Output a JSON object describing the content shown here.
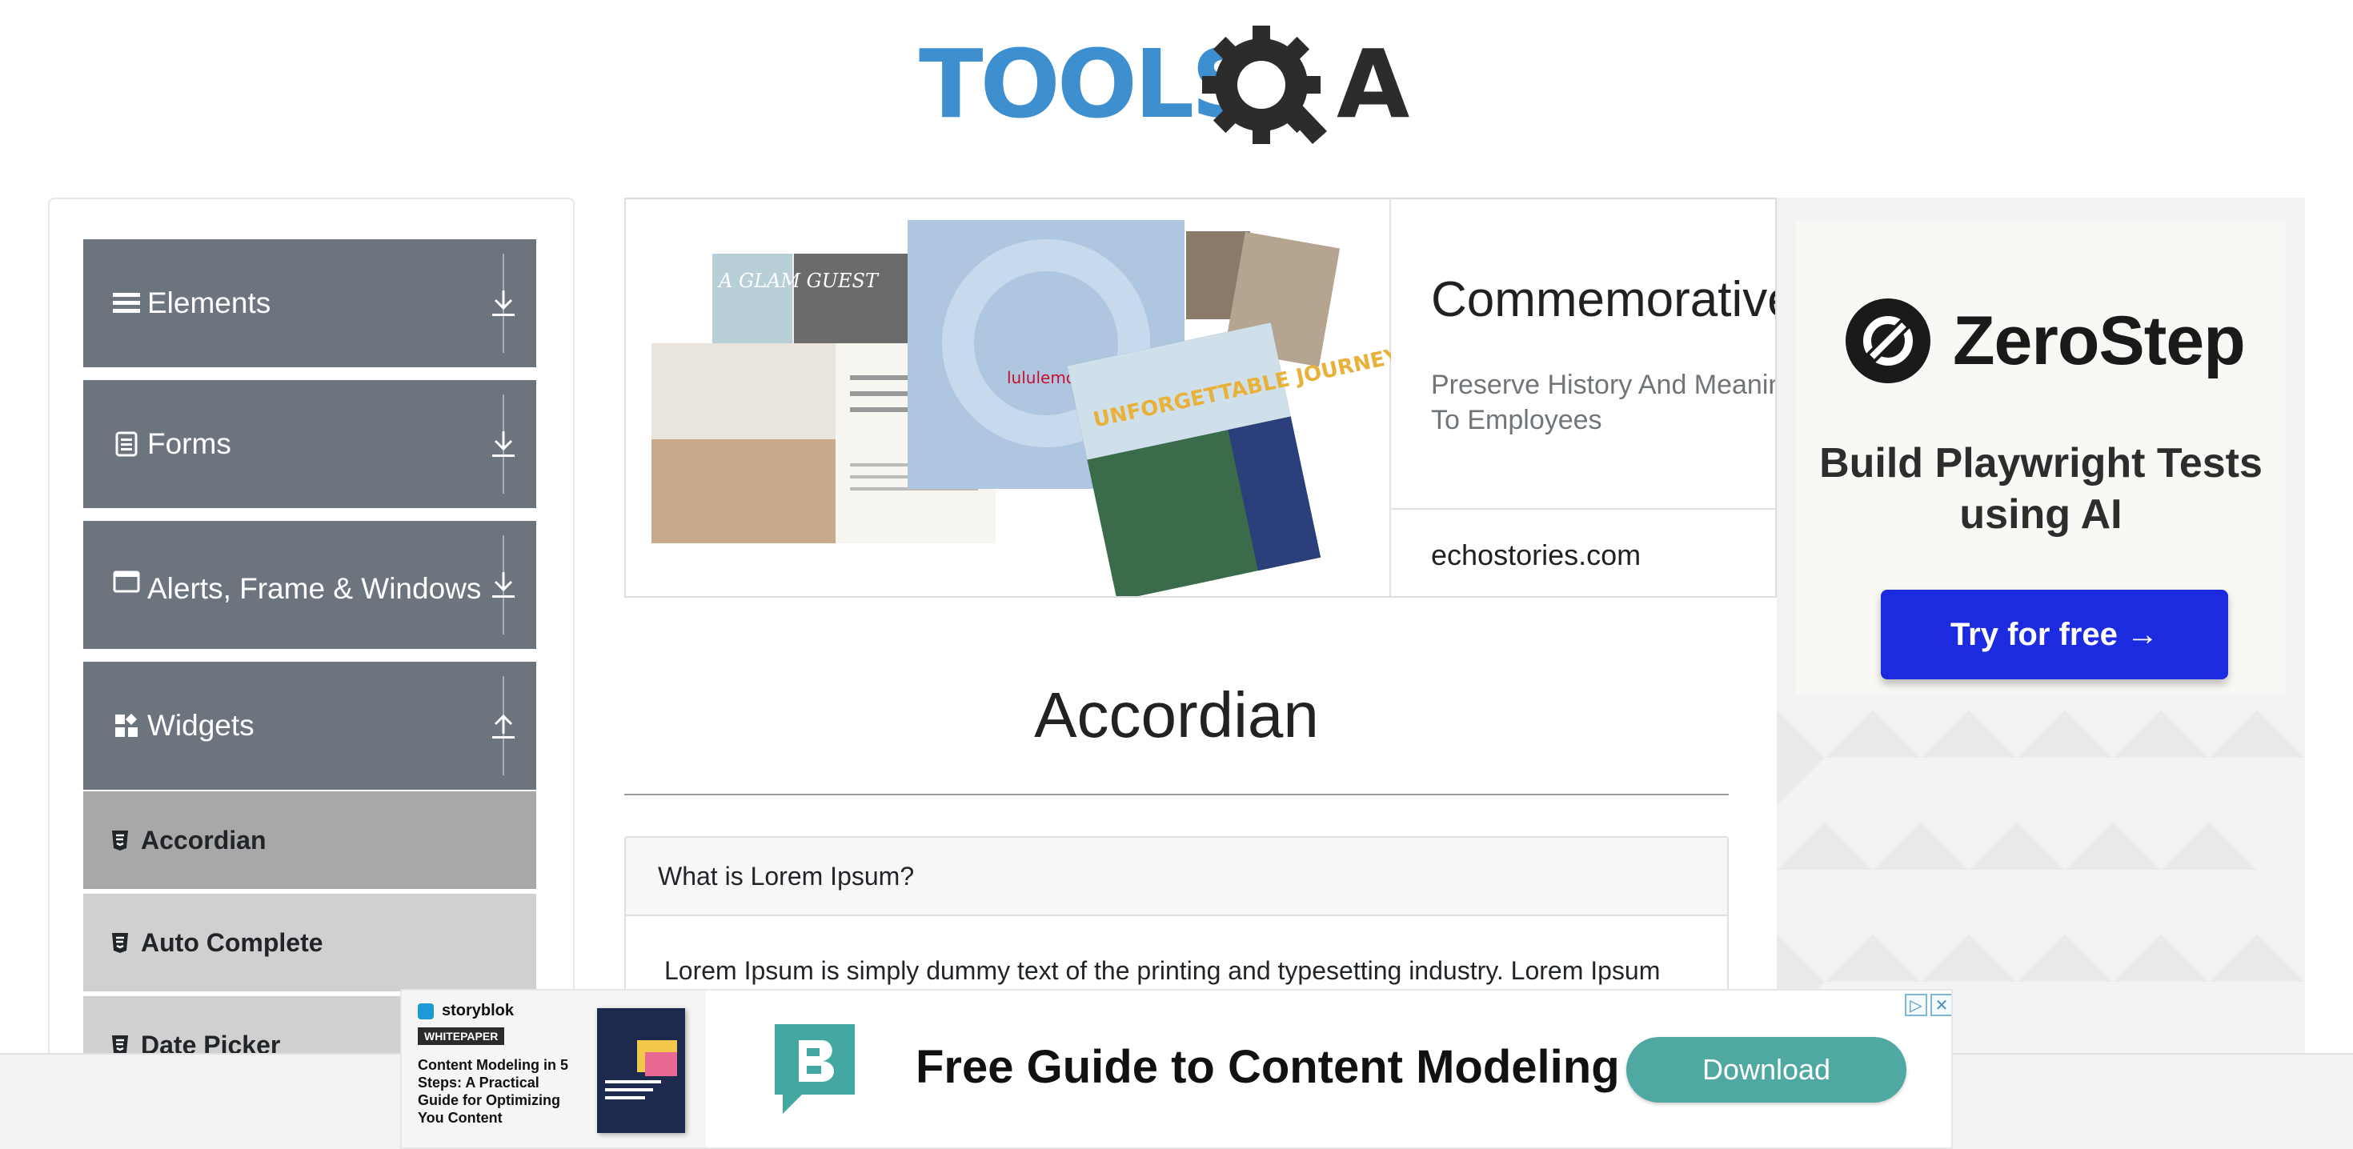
{
  "logo": {
    "text": "TOOLSQA"
  },
  "sidebar": {
    "groups": [
      {
        "label": "Elements",
        "icon": "menu-icon",
        "arrow": "download-arrow-icon"
      },
      {
        "label": "Forms",
        "icon": "document-icon",
        "arrow": "download-arrow-icon"
      },
      {
        "label": "Alerts, Frame & Windows",
        "icon": "window-icon",
        "arrow": "download-arrow-icon"
      },
      {
        "label": "Widgets",
        "icon": "widgets-icon",
        "arrow": "upload-arrow-icon"
      }
    ],
    "widget_items": [
      {
        "label": "Accordian",
        "active": true
      },
      {
        "label": "Auto Complete",
        "active": false
      },
      {
        "label": "Date Picker",
        "active": false
      }
    ]
  },
  "top_ad": {
    "title": "Commemorative",
    "description": "Preserve History And Meaning Culture and Values To Employees",
    "domain": "echostories.com",
    "image_texts": {
      "magazine": "A GLAM GUEST",
      "brand": "lululemon",
      "book": "UNFORGETTABLE JOURNEY"
    }
  },
  "right_ad": {
    "brand": "ZeroStep",
    "tagline": "Build Playwright Tests using AI",
    "cta": "Try for free →"
  },
  "main": {
    "title": "Accordian",
    "section": {
      "header": "What is Lorem Ipsum?",
      "body": "Lorem Ipsum is simply dummy text of the printing and typesetting industry. Lorem Ipsum"
    }
  },
  "bottom_ad": {
    "brand": "storyblok",
    "badge": "WHITEPAPER",
    "subtitle": "Content Modeling in 5 Steps: A Practical Guide for Optimizing You Content",
    "headline": "Free Guide to Content Modeling",
    "cta": "Download"
  },
  "colors": {
    "sidebar_group": "#6c757d",
    "sidebar_active_item": "#a8a8a8",
    "sidebar_item": "#d0d0d0",
    "logo_blue": "#3d8fd0",
    "zerostep_button": "#1c2be0",
    "download_button": "#4fa9a2"
  }
}
